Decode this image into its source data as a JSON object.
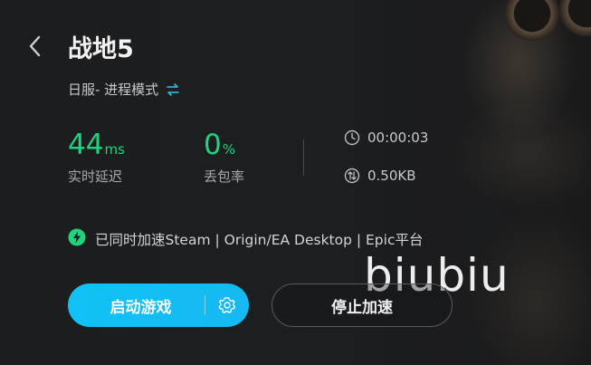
{
  "header": {
    "title": "战地5",
    "mode_text": "日服- 进程模式"
  },
  "stats": {
    "latency": {
      "value": "44",
      "unit": "ms",
      "label": "实时延迟"
    },
    "packet_loss": {
      "value": "0",
      "unit": "%",
      "label": "丢包率"
    },
    "duration": "00:00:03",
    "traffic": "0.50KB"
  },
  "sync_notice": "已同时加速Steam | Origin/EA Desktop | Epic平台",
  "watermark": "biubiu",
  "buttons": {
    "launch_label": "启动游戏",
    "stop_label": "停止加速"
  },
  "colors": {
    "accent": "#16b9f2",
    "good": "#1fd47d",
    "background": "#1c1d1f"
  },
  "icons": [
    "back-arrow-icon",
    "swap-icon",
    "clock-icon",
    "traffic-icon",
    "lightning-icon",
    "gear-icon"
  ]
}
